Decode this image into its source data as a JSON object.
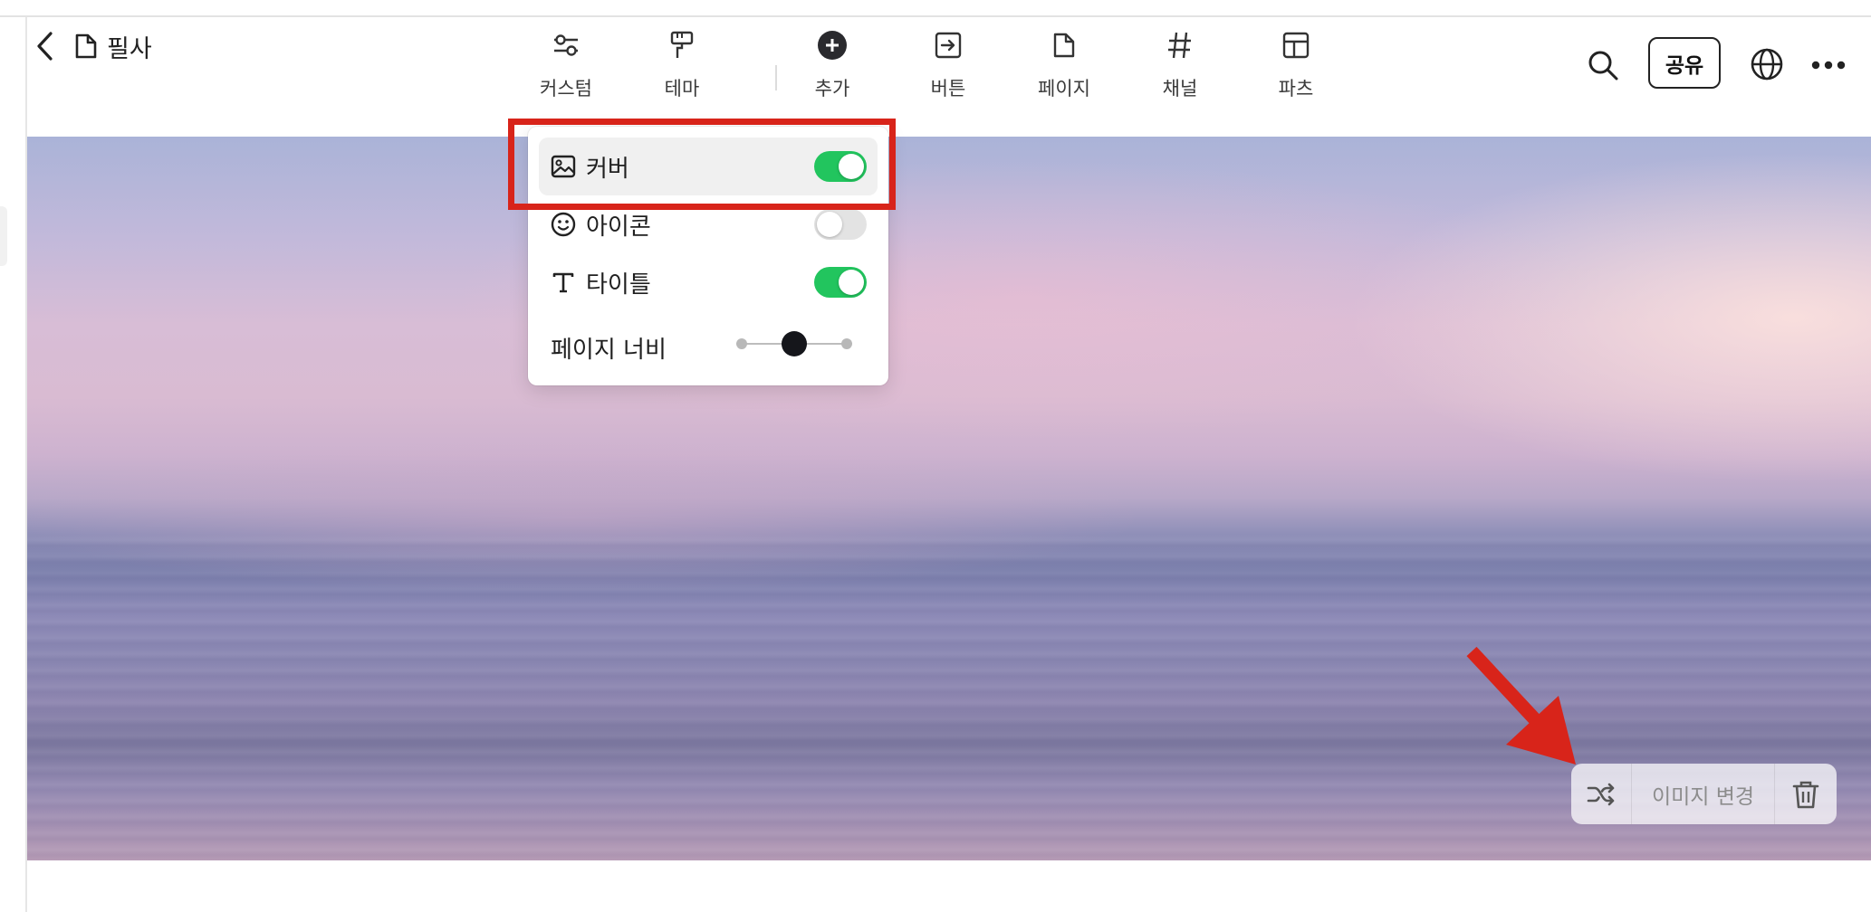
{
  "header": {
    "breadcrumb_title": "필사",
    "share_label": "공유"
  },
  "toolbar": [
    {
      "label": "커스텀",
      "icon": "sliders-icon"
    },
    {
      "label": "테마",
      "icon": "paint-roller-icon"
    },
    {
      "label": "추가",
      "icon": "plus-circle-icon"
    },
    {
      "label": "버튼",
      "icon": "button-arrow-icon"
    },
    {
      "label": "페이지",
      "icon": "page-icon"
    },
    {
      "label": "채널",
      "icon": "hash-icon"
    },
    {
      "label": "파츠",
      "icon": "layout-icon"
    }
  ],
  "customize_menu": {
    "items": [
      {
        "label": "커버",
        "icon": "image-icon",
        "enabled": true
      },
      {
        "label": "아이콘",
        "icon": "smiley-icon",
        "enabled": false
      },
      {
        "label": "타이틀",
        "icon": "text-icon",
        "enabled": true
      }
    ],
    "page_width_label": "페이지 너비",
    "page_width_level": "2 of 3"
  },
  "cover_actions": {
    "change_image_label": "이미지 변경"
  },
  "colors": {
    "toggle_on": "#22c55e",
    "annotation_red": "#d8241a"
  }
}
